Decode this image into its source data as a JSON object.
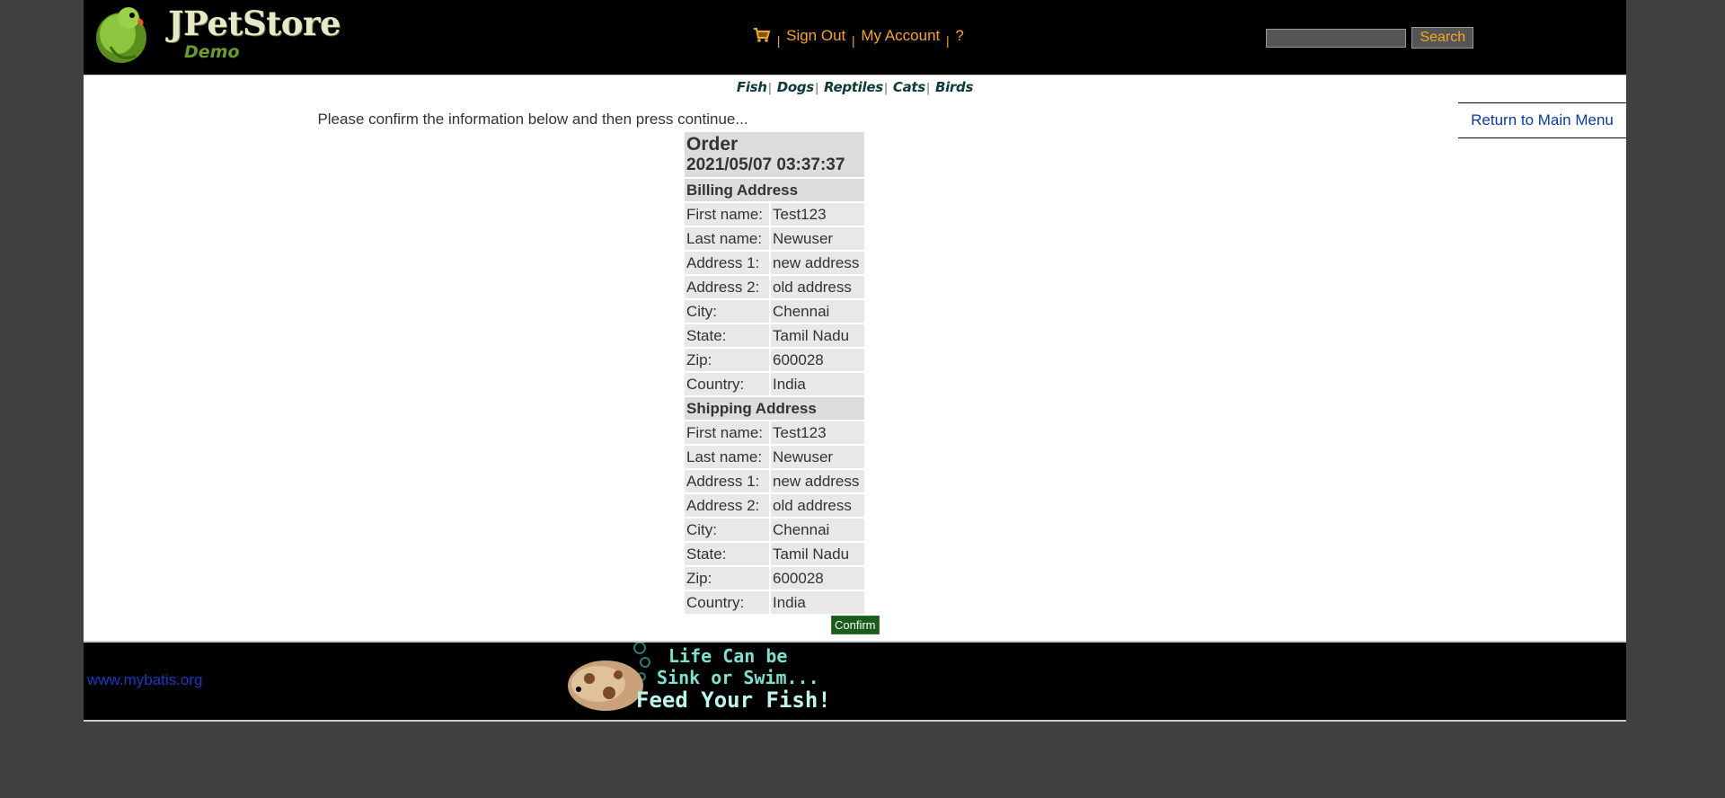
{
  "header": {
    "logo_title": "JPetStore",
    "logo_sub": "Demo",
    "menu": {
      "cart_icon": "cart-icon",
      "sign_out": "Sign Out",
      "my_account": "My Account",
      "help": "?",
      "separator": "|"
    },
    "search": {
      "value": "",
      "button": "Search"
    }
  },
  "quicklinks": [
    "Fish",
    "Dogs",
    "Reptiles",
    "Cats",
    "Birds"
  ],
  "return_link": "Return to Main Menu",
  "instructions": "Please confirm the information below and then press continue...",
  "order": {
    "title": "Order",
    "datetime": "2021/05/07 03:37:37",
    "billing_heading": "Billing Address",
    "billing": [
      {
        "label": "First name:",
        "value": "Test123"
      },
      {
        "label": "Last name:",
        "value": "Newuser"
      },
      {
        "label": "Address 1:",
        "value": "new address"
      },
      {
        "label": "Address 2:",
        "value": "old address"
      },
      {
        "label": "City:",
        "value": "Chennai"
      },
      {
        "label": "State:",
        "value": "Tamil Nadu"
      },
      {
        "label": "Zip:",
        "value": "600028"
      },
      {
        "label": "Country:",
        "value": "India"
      }
    ],
    "shipping_heading": "Shipping Address",
    "shipping": [
      {
        "label": "First name:",
        "value": "Test123"
      },
      {
        "label": "Last name:",
        "value": "Newuser"
      },
      {
        "label": "Address 1:",
        "value": "new address"
      },
      {
        "label": "Address 2:",
        "value": "old address"
      },
      {
        "label": "City:",
        "value": "Chennai"
      },
      {
        "label": "State:",
        "value": "Tamil Nadu"
      },
      {
        "label": "Zip:",
        "value": "600028"
      },
      {
        "label": "Country:",
        "value": "India"
      }
    ],
    "confirm_button": "Confirm"
  },
  "footer": {
    "link": "www.mybatis.org",
    "banner_lines": [
      "Life Can be",
      "Sink or Swim...",
      "Feed Your Fish!"
    ]
  },
  "colors": {
    "header_bg": "#000000",
    "menu_text": "#f5a623",
    "link_blue": "#0b3aa0",
    "confirm_green": "#1a5c1a",
    "banner_text": "#7fe0d0"
  }
}
